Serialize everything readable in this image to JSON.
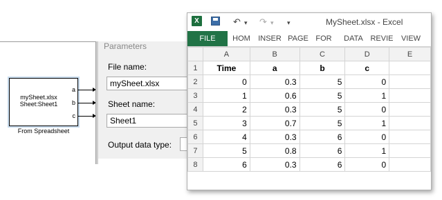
{
  "simulink": {
    "block": {
      "line1": "mySheet.xlsx",
      "line2": "Sheet:Sheet1",
      "ports": [
        "a",
        "b",
        "c"
      ],
      "caption": "From Spreadsheet"
    }
  },
  "dialog": {
    "section_title": "Parameters",
    "file_name_label": "File name:",
    "file_name_value": "mySheet.xlsx",
    "sheet_name_label": "Sheet name:",
    "sheet_name_value": "Sheet1",
    "output_type_label": "Output data type:"
  },
  "excel": {
    "title": "MySheet.xlsx - Excel",
    "tabs": [
      "FILE",
      "HOM",
      "INSER",
      "PAGE",
      "FOR",
      "DATA",
      "REVIE",
      "VIEW"
    ],
    "column_headers": [
      "A",
      "B",
      "C",
      "D",
      "E"
    ],
    "rows": [
      {
        "n": "1",
        "cells": [
          "Time",
          "a",
          "b",
          "c",
          ""
        ]
      },
      {
        "n": "2",
        "cells": [
          "0",
          "0.3",
          "5",
          "0",
          ""
        ]
      },
      {
        "n": "3",
        "cells": [
          "1",
          "0.6",
          "5",
          "1",
          ""
        ]
      },
      {
        "n": "4",
        "cells": [
          "2",
          "0.3",
          "5",
          "0",
          ""
        ]
      },
      {
        "n": "5",
        "cells": [
          "3",
          "0.7",
          "5",
          "1",
          ""
        ]
      },
      {
        "n": "6",
        "cells": [
          "4",
          "0.3",
          "6",
          "0",
          ""
        ]
      },
      {
        "n": "7",
        "cells": [
          "5",
          "0.8",
          "6",
          "1",
          ""
        ]
      },
      {
        "n": "8",
        "cells": [
          "6",
          "0.3",
          "6",
          "0",
          ""
        ]
      }
    ],
    "colors": {
      "file_tab": "#217346",
      "header_bg": "#f2f2f2",
      "gridline": "#d4d4d4"
    },
    "icons": [
      "excel-logo-icon",
      "save-icon",
      "undo-icon",
      "redo-icon",
      "customize-qat-icon"
    ]
  }
}
